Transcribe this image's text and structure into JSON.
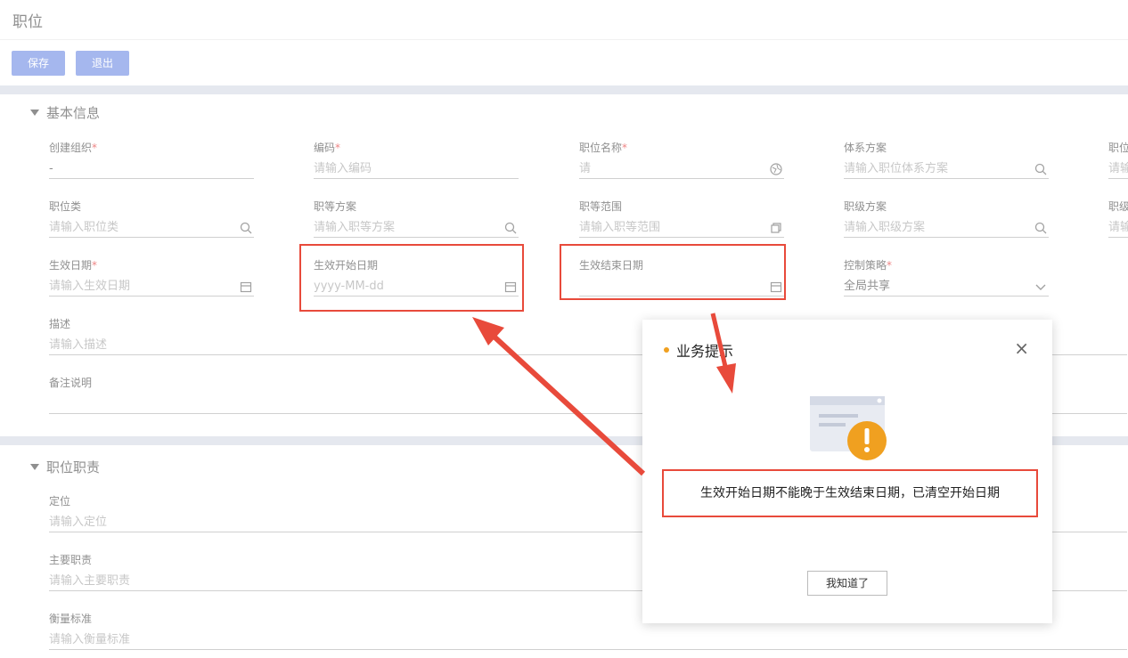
{
  "page": {
    "title": "职位"
  },
  "toolbar": {
    "save_label": "保存",
    "exit_label": "退出"
  },
  "sections": {
    "basic": "基本信息",
    "duty": "职位职责"
  },
  "fields": {
    "org": {
      "label": "创建组织",
      "value": "-"
    },
    "code": {
      "label": "编码",
      "placeholder": "请输入编码"
    },
    "name": {
      "label": "职位名称",
      "value": "请"
    },
    "system": {
      "label": "体系方案",
      "placeholder": "请输入职位体系方案"
    },
    "col5": {
      "label": "职位",
      "placeholder": "请输"
    },
    "pos_type": {
      "label": "职位类",
      "placeholder": "请输入职位类"
    },
    "grade_plan": {
      "label": "职等方案",
      "placeholder": "请输入职等方案"
    },
    "grade_range": {
      "label": "职等范围",
      "placeholder": "请输入职等范围"
    },
    "level_plan": {
      "label": "职级方案",
      "placeholder": "请输入职级方案"
    },
    "col5b": {
      "label": "职级",
      "placeholder": "请输"
    },
    "eff_date": {
      "label": "生效日期",
      "placeholder": "请输入生效日期"
    },
    "eff_start": {
      "label": "生效开始日期",
      "placeholder": "yyyy-MM-dd"
    },
    "eff_end": {
      "label": "生效结束日期",
      "value": ""
    },
    "policy": {
      "label": "控制策略",
      "value": "全局共享"
    },
    "desc": {
      "label": "描述",
      "placeholder": "请输入描述"
    },
    "remark": {
      "label": "备注说明",
      "placeholder": ""
    },
    "position": {
      "label": "定位",
      "placeholder": "请输入定位"
    },
    "main_duty": {
      "label": "主要职责",
      "placeholder": "请输入主要职责"
    },
    "measure": {
      "label": "衡量标准",
      "placeholder": "请输入衡量标准"
    }
  },
  "modal": {
    "title": "业务提示",
    "message": "生效开始日期不能晚于生效结束日期，已清空开始日期",
    "ok_label": "我知道了",
    "close_icon": "close-icon"
  },
  "colors": {
    "accent": "#5b7ce0",
    "highlight": "#e84a3b",
    "warning": "#f0a020"
  }
}
